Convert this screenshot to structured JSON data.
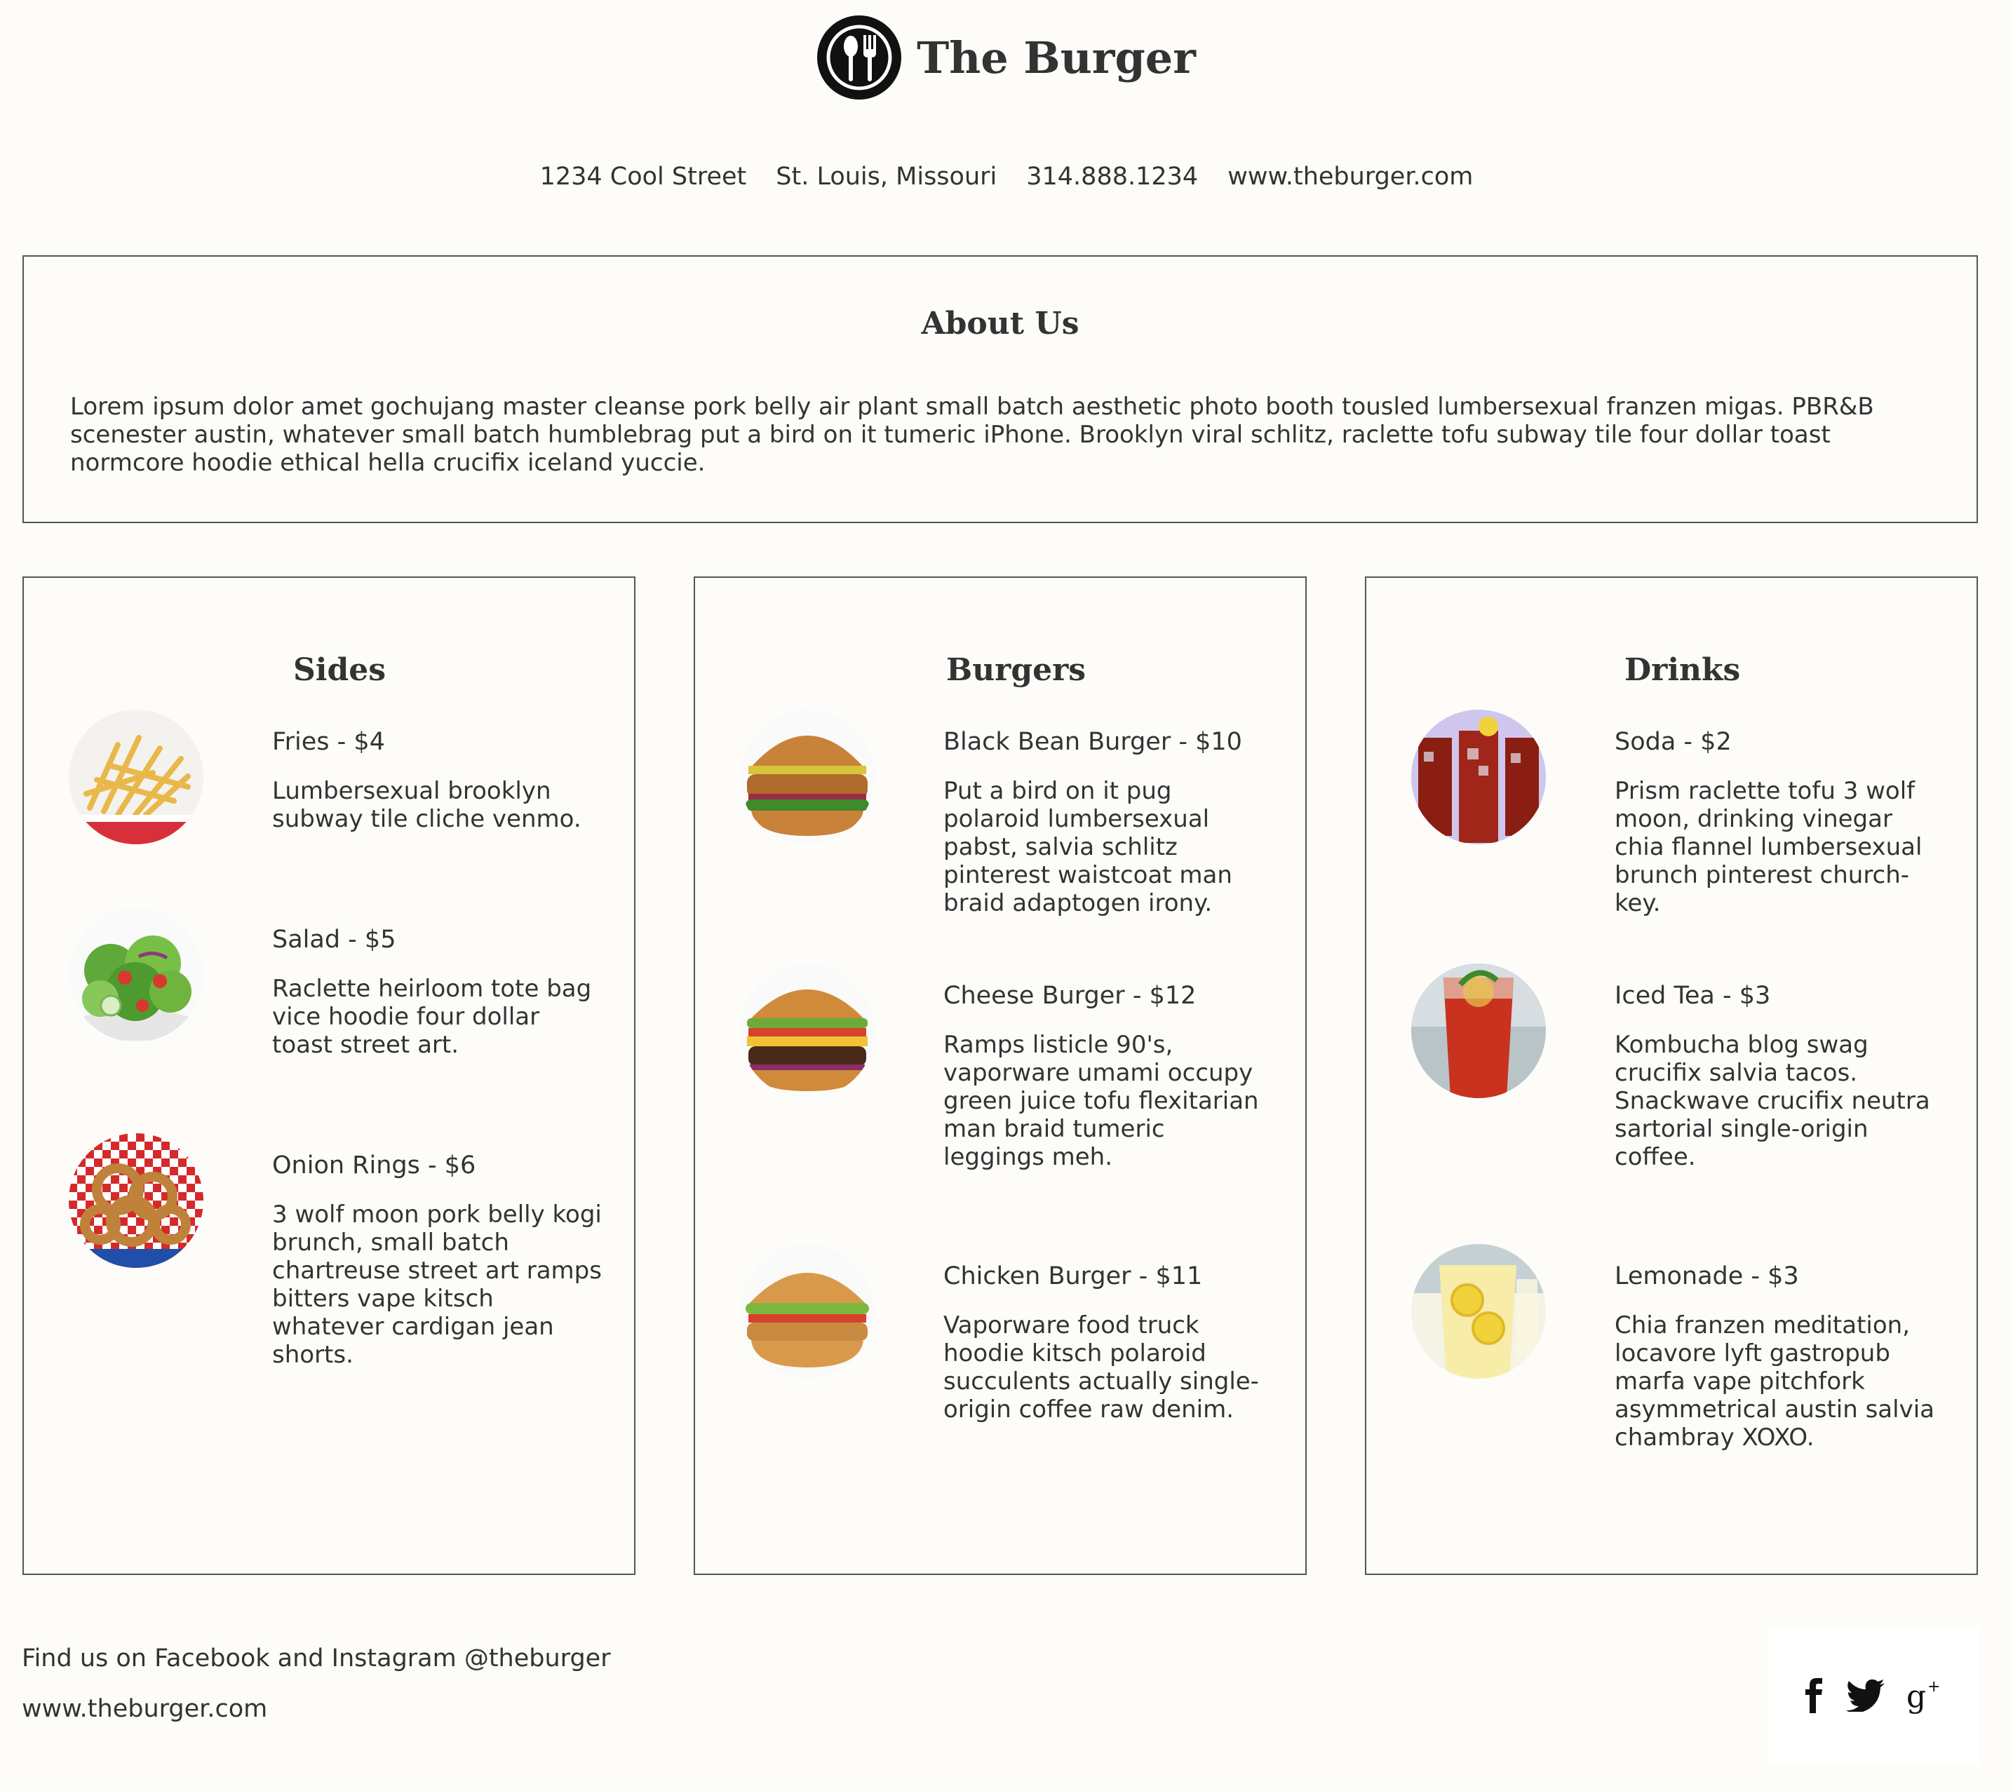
{
  "header": {
    "brand_name": "The Burger",
    "logo_icon": "spoon-fork-icon"
  },
  "contact": {
    "address": "1234 Cool Street",
    "city": "St. Louis, Missouri",
    "phone": "314.888.1234",
    "website": "www.theburger.com"
  },
  "about": {
    "title": "About Us",
    "text": "Lorem ipsum dolor amet gochujang master cleanse pork belly air plant small batch aesthetic photo booth tousled lumbersexual franzen migas. PBR&B scenester austin, whatever small batch humblebrag put a bird on it tumeric iPhone. Brooklyn viral schlitz, raclette tofu subway tile four dollar toast normcore hoodie ethical hella crucifix iceland yuccie."
  },
  "menu": {
    "sides": {
      "title": "Sides",
      "items": [
        {
          "title": "Fries - $4",
          "desc": "Lumbersexual brooklyn subway tile cliche venmo.",
          "image": "fries-photo"
        },
        {
          "title": "Salad - $5",
          "desc": "Raclette heirloom tote bag vice hoodie four dollar toast street art.",
          "image": "salad-photo"
        },
        {
          "title": "Onion Rings - $6",
          "desc": "3 wolf moon pork belly kogi brunch, small batch chartreuse street art ramps bitters vape kitsch whatever cardigan jean shorts.",
          "image": "onion-rings-photo"
        }
      ]
    },
    "burgers": {
      "title": "Burgers",
      "items": [
        {
          "title": "Black Bean Burger - $10",
          "desc": "Put a bird on it pug polaroid lumbersexual pabst, salvia schlitz pinterest waistcoat man braid adaptogen irony.",
          "image": "black-bean-burger-photo"
        },
        {
          "title": "Cheese Burger - $12",
          "desc": "Ramps listicle 90's, vaporware umami occupy green juice tofu flexitarian man braid tumeric leggings meh.",
          "image": "cheese-burger-photo"
        },
        {
          "title": "Chicken Burger - $11",
          "desc": "Vaporware food truck hoodie kitsch polaroid succulents actually single-origin coffee raw denim.",
          "image": "chicken-burger-photo"
        }
      ]
    },
    "drinks": {
      "title": "Drinks",
      "items": [
        {
          "title": "Soda - $2",
          "desc": "Prism raclette tofu 3 wolf moon, drinking vinegar chia flannel lumbersexual brunch pinterest church-key.",
          "image": "soda-photo"
        },
        {
          "title": "Iced Tea - $3",
          "desc": "Kombucha blog swag crucifix salvia tacos. Snackwave crucifix neutra sartorial single-origin coffee.",
          "image": "iced-tea-photo"
        },
        {
          "title": "Lemonade - $3",
          "desc": "Chia franzen meditation, locavore lyft gastropub marfa vape pitchfork asymmetrical austin salvia chambray XOXO.",
          "image": "lemonade-photo"
        }
      ]
    }
  },
  "footer": {
    "social_text": "Find us on Facebook and Instagram @theburger",
    "website": "www.theburger.com",
    "social_icons": [
      "facebook-icon",
      "twitter-icon",
      "google-plus-icon"
    ]
  },
  "colors": {
    "background": "#fdfcf9",
    "text": "#2e2e2e",
    "border": "#555555"
  }
}
